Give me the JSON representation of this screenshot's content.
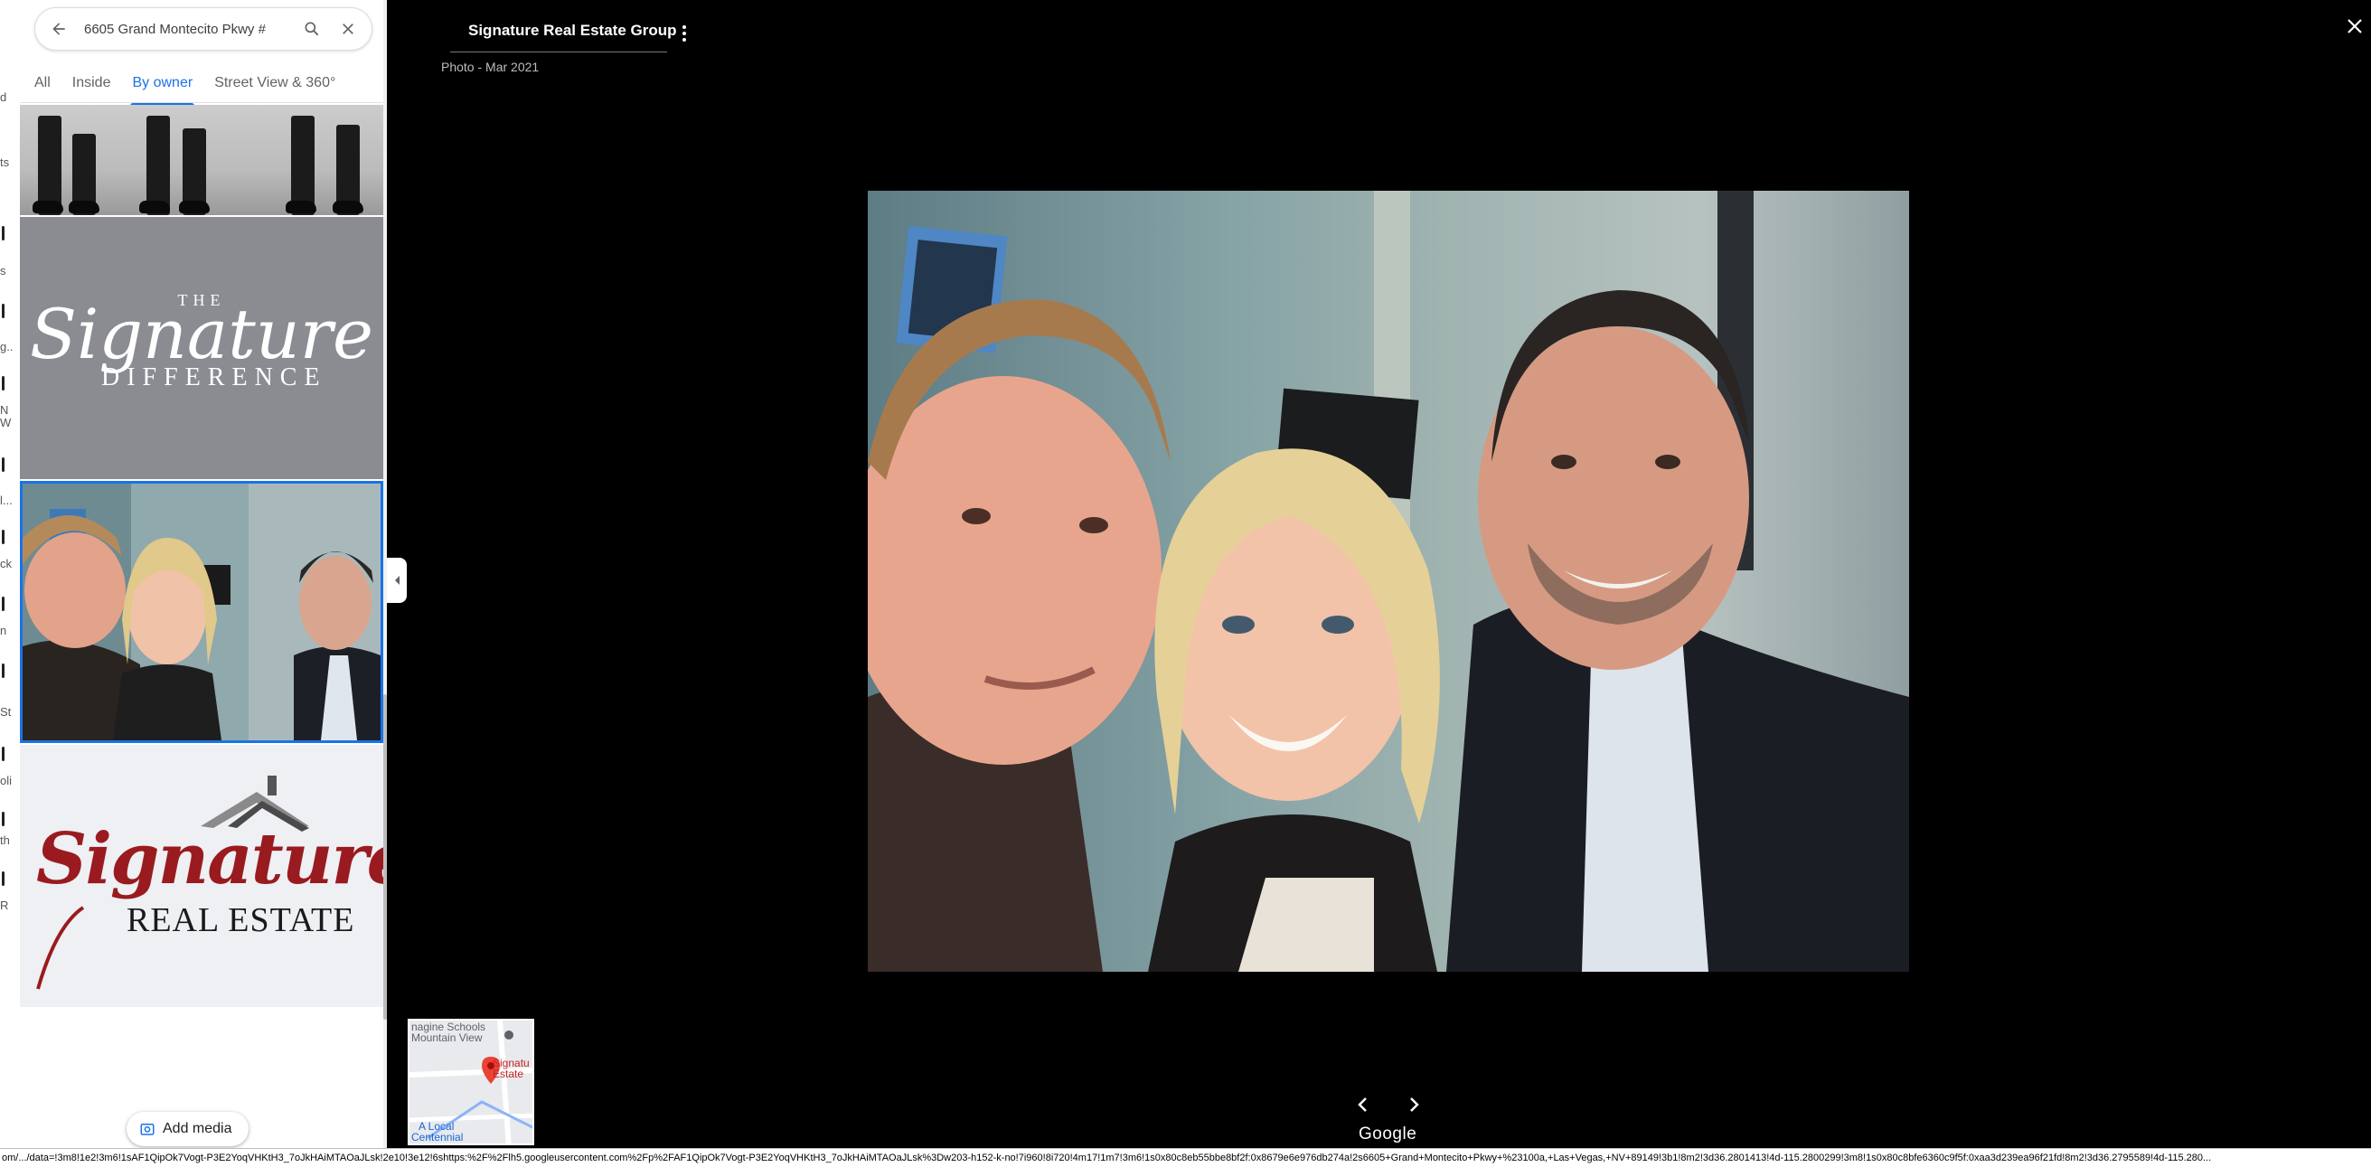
{
  "search": {
    "value": "6605 Grand Montecito Pkwy #",
    "back_icon": "arrow-left-icon",
    "search_icon": "search-icon",
    "clear_icon": "close-icon"
  },
  "tabs": [
    {
      "label": "All",
      "active": false
    },
    {
      "label": "Inside",
      "active": false
    },
    {
      "label": "By owner",
      "active": true
    },
    {
      "label": "Street View & 360°",
      "active": false
    }
  ],
  "thumbnails": {
    "signature_difference": {
      "the": "THE",
      "signature": "Signature",
      "difference": "DIFFERENCE"
    },
    "signature_logo": {
      "signature": "Signature",
      "real_estate": "REAL ESTATE"
    }
  },
  "add_media": {
    "label": "Add media",
    "icon": "add-photo-icon"
  },
  "viewer": {
    "owner": "Signature Real Estate Group",
    "date": "Photo - Mar 2021",
    "close_icon": "close-icon",
    "more_icon": "more-vert-icon",
    "prev_icon": "chevron-left-icon",
    "next_icon": "chevron-right-icon",
    "brand": "Google"
  },
  "minimap": {
    "label_1": "nagine Schools",
    "label_2": "Mountain View",
    "label_3": "Signatu",
    "label_4": "Estate",
    "label_5": "A Local",
    "label_6": "Centennial"
  },
  "status_url": "om/.../data=!3m8!1e2!3m6!1sAF1QipOk7Vogt-P3E2YoqVHKtH3_7oJkHAiMTAOaJLsk!2e10!3e12!6shttps:%2F%2Flh5.googleusercontent.com%2Fp%2FAF1QipOk7Vogt-P3E2YoqVHKtH3_7oJkHAiMTAOaJLsk%3Dw203-h152-k-no!7i960!8i720!4m17!1m7!3m6!1s0x80c8eb55bbe8bf2f:0x8679e6e976db274a!2s6605+Grand+Montecito+Pkwy+%23100a,+Las+Vegas,+NV+89149!3b1!8m2!3d36.2801413!4d-115.2800299!3m8!1s0x80c8bfe6360c9f5f:0xaa3d239ea96f21fd!8m2!3d36.2795589!4d-115.280..."
}
